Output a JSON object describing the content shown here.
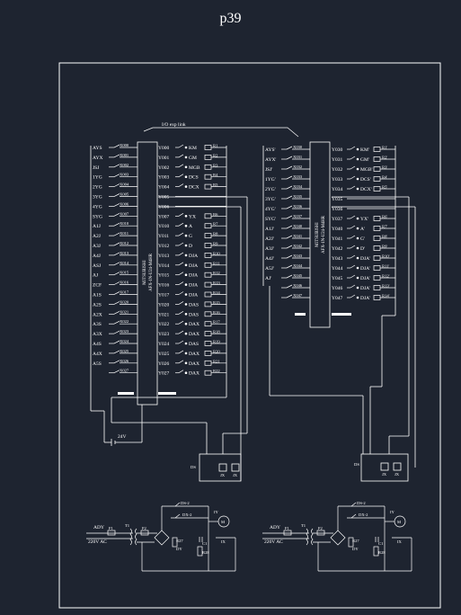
{
  "page": {
    "title": "p39"
  },
  "link_label": "I/O exp link",
  "plc_left": {
    "model": "MITSUBISHI\nAFX-1N-U24-M4HR",
    "model_line1": "MITSUBISHI",
    "model_line2": "AFX-1N-U24-M4HR",
    "inputs": [
      {
        "name": "AYS",
        "addr": "X000"
      },
      {
        "name": "AYX",
        "addr": "X001"
      },
      {
        "name": "JSJ",
        "addr": "X002"
      },
      {
        "name": "1YG",
        "addr": "X003"
      },
      {
        "name": "2YG",
        "addr": "X004"
      },
      {
        "name": "3YG",
        "addr": "X005"
      },
      {
        "name": "4YG",
        "addr": "X006"
      },
      {
        "name": "SYG",
        "addr": "X007"
      },
      {
        "name": "A1J",
        "addr": "X010"
      },
      {
        "name": "A2J",
        "addr": "X011"
      },
      {
        "name": "A3J",
        "addr": "X012"
      },
      {
        "name": "A4J",
        "addr": "X013"
      },
      {
        "name": "ASJ",
        "addr": "X014"
      },
      {
        "name": "AJ",
        "addr": "X015"
      },
      {
        "name": "ZCF",
        "addr": "X016"
      },
      {
        "name": "A1S",
        "addr": "X017"
      },
      {
        "name": "A2S",
        "addr": "X020"
      },
      {
        "name": "A2X",
        "addr": "X021"
      },
      {
        "name": "A3S",
        "addr": "X022"
      },
      {
        "name": "A3X",
        "addr": "X023"
      },
      {
        "name": "A4S",
        "addr": "X024"
      },
      {
        "name": "A4X",
        "addr": "X025"
      },
      {
        "name": "A5S",
        "addr": "X026"
      },
      {
        "name": "",
        "addr": "X027"
      }
    ],
    "outputs": [
      {
        "addr": "Y000",
        "load": "KM",
        "relay": "R1"
      },
      {
        "addr": "Y001",
        "load": "GM",
        "relay": "R2"
      },
      {
        "addr": "Y002",
        "load": "MGB",
        "relay": "R3"
      },
      {
        "addr": "Y003",
        "load": "DCS",
        "relay": "R4"
      },
      {
        "addr": "Y004",
        "load": "DCX",
        "relay": "R5"
      },
      {
        "addr": "Y005",
        "load": "",
        "relay": ""
      },
      {
        "addr": "Y006",
        "load": "",
        "relay": ""
      },
      {
        "addr": "Y007",
        "load": "YX",
        "relay": "R6"
      },
      {
        "addr": "Y010",
        "load": "A",
        "relay": "R7"
      },
      {
        "addr": "Y011",
        "load": "G",
        "relay": "R8"
      },
      {
        "addr": "Y012",
        "load": "D",
        "relay": "R9"
      },
      {
        "addr": "Y013",
        "load": "DJA",
        "relay": "R10"
      },
      {
        "addr": "Y014",
        "load": "DJA",
        "relay": "R11"
      },
      {
        "addr": "Y015",
        "load": "DJA",
        "relay": "R12"
      },
      {
        "addr": "Y016",
        "load": "DJA",
        "relay": "R13"
      },
      {
        "addr": "Y017",
        "load": "DJA",
        "relay": "R14"
      },
      {
        "addr": "Y020",
        "load": "DAS",
        "relay": "R15"
      },
      {
        "addr": "Y021",
        "load": "DAS",
        "relay": "R16"
      },
      {
        "addr": "Y022",
        "load": "DAX",
        "relay": "R17"
      },
      {
        "addr": "Y023",
        "load": "DAX",
        "relay": "R18"
      },
      {
        "addr": "Y024",
        "load": "DAS",
        "relay": "R19"
      },
      {
        "addr": "Y025",
        "load": "DAX",
        "relay": "R20"
      },
      {
        "addr": "Y026",
        "load": "DAX",
        "relay": "R21"
      },
      {
        "addr": "Y027",
        "load": "DAX",
        "relay": "R22"
      }
    ]
  },
  "plc_right": {
    "model_line1": "MITSUBISHI",
    "model_line2": "AFX-1N-U24-M4HR",
    "inputs": [
      {
        "name": "AYS'",
        "addr": "X030"
      },
      {
        "name": "AYX'",
        "addr": "X031"
      },
      {
        "name": "JSJ'",
        "addr": "X032"
      },
      {
        "name": "1YG'",
        "addr": "X033"
      },
      {
        "name": "2YG'",
        "addr": "X034"
      },
      {
        "name": "3YG'",
        "addr": "X035"
      },
      {
        "name": "4YG'",
        "addr": "X036"
      },
      {
        "name": "SYG'",
        "addr": "X037"
      },
      {
        "name": "A1J'",
        "addr": "X040"
      },
      {
        "name": "A2J'",
        "addr": "X041"
      },
      {
        "name": "A3J'",
        "addr": "X042"
      },
      {
        "name": "A4J'",
        "addr": "X043"
      },
      {
        "name": "A5J'",
        "addr": "X044"
      },
      {
        "name": "AJ'",
        "addr": "X045"
      },
      {
        "name": "",
        "addr": "X046"
      },
      {
        "name": "",
        "addr": "X047"
      }
    ],
    "outputs": [
      {
        "addr": "Y030",
        "load": "KM'",
        "relay": "R1'"
      },
      {
        "addr": "Y031",
        "load": "GM'",
        "relay": "R2'"
      },
      {
        "addr": "Y032",
        "load": "MGB'",
        "relay": "R3'"
      },
      {
        "addr": "Y033",
        "load": "DCS'",
        "relay": "R4'"
      },
      {
        "addr": "Y034",
        "load": "DCX'",
        "relay": "R5'"
      },
      {
        "addr": "Y035",
        "load": "",
        "relay": ""
      },
      {
        "addr": "Y036",
        "load": "",
        "relay": ""
      },
      {
        "addr": "Y037",
        "load": "YX'",
        "relay": "R6'"
      },
      {
        "addr": "Y040",
        "load": "A'",
        "relay": "R7'"
      },
      {
        "addr": "Y041",
        "load": "G'",
        "relay": "R8'"
      },
      {
        "addr": "Y042",
        "load": "D'",
        "relay": "R9'"
      },
      {
        "addr": "Y043",
        "load": "DJA'",
        "relay": "R10'"
      },
      {
        "addr": "Y044",
        "load": "DJA'",
        "relay": "R11'"
      },
      {
        "addr": "Y045",
        "load": "DJA'",
        "relay": "R12'"
      },
      {
        "addr": "Y046",
        "load": "DJA'",
        "relay": "R13'"
      },
      {
        "addr": "Y047",
        "load": "DJA'",
        "relay": "R14'"
      }
    ]
  },
  "supply": {
    "dc_label": "24V"
  },
  "relay_block": {
    "labels": [
      "DS",
      "JX",
      "JX"
    ]
  },
  "motor_circuit": {
    "input_label": "ADY",
    "ac_label": "220V AC",
    "fuse": "F1",
    "transformer": "T1",
    "fuse2": "F2",
    "contacts": [
      "DS-2",
      "DX-2"
    ],
    "motor": "M",
    "items": [
      "IY",
      "R27",
      "DY",
      "C1",
      "R28",
      "IX"
    ]
  }
}
